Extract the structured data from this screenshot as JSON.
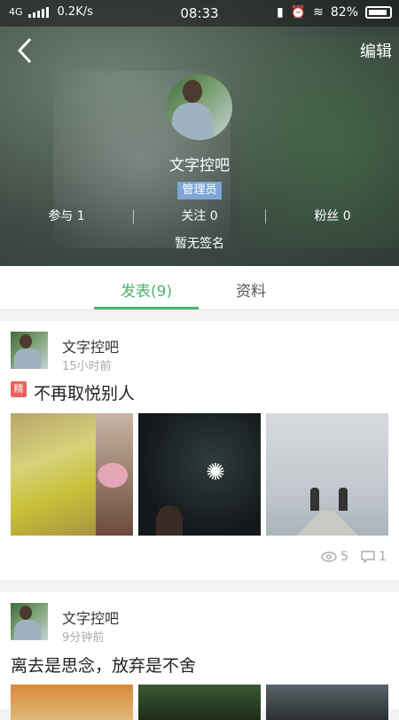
{
  "status_bar": {
    "network": "4G",
    "speed": "0.2K/s",
    "time": "08:33",
    "battery": "82%"
  },
  "header": {
    "edit_label": "编辑",
    "profile_name": "文字控吧",
    "role": "管理员",
    "stats": {
      "participate": "参与 1",
      "following": "关注 0",
      "followers": "粉丝 0"
    },
    "signature": "暂无签名"
  },
  "tabs": {
    "posts": "发表(9)",
    "profile": "资料"
  },
  "posts": [
    {
      "author": "文字控吧",
      "time": "15小时前",
      "badge": "精",
      "title": "不再取悦别人",
      "views": "5",
      "comments": "1"
    },
    {
      "author": "文字控吧",
      "time": "9分钟前",
      "title": "离去是思念，放弃是不舍"
    }
  ],
  "colors": {
    "accent": "#4cb36a",
    "role_badge": "#7ea6d6",
    "featured_badge": "#e8625a"
  }
}
